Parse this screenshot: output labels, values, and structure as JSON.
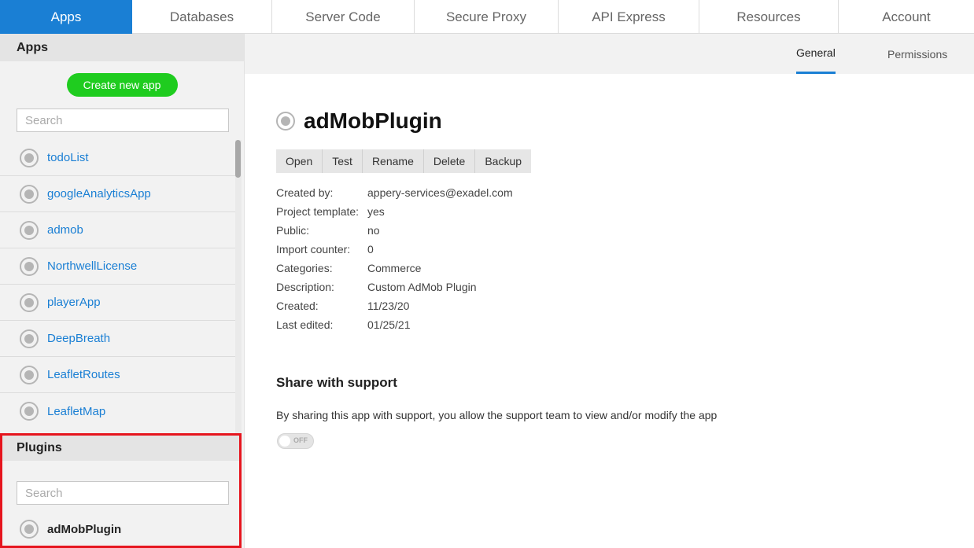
{
  "topnav": {
    "tabs": [
      {
        "label": "Apps",
        "active": true
      },
      {
        "label": "Databases"
      },
      {
        "label": "Server Code"
      },
      {
        "label": "Secure Proxy"
      },
      {
        "label": "API Express"
      },
      {
        "label": "Resources"
      },
      {
        "label": "Account"
      }
    ]
  },
  "sidebar": {
    "apps_heading": "Apps",
    "create_button": "Create new app",
    "apps_search_placeholder": "Search",
    "apps": [
      {
        "label": "todoList"
      },
      {
        "label": "googleAnalyticsApp"
      },
      {
        "label": "admob"
      },
      {
        "label": "NorthwellLicense"
      },
      {
        "label": "playerApp"
      },
      {
        "label": "DeepBreath"
      },
      {
        "label": "LeafletRoutes"
      },
      {
        "label": "LeafletMap"
      }
    ],
    "plugins_heading": "Plugins",
    "plugins_search_placeholder": "Search",
    "plugins": [
      {
        "label": "adMobPlugin"
      }
    ]
  },
  "subnav": {
    "general": "General",
    "permissions": "Permissions"
  },
  "main": {
    "title": "adMobPlugin",
    "actions": {
      "open": "Open",
      "test": "Test",
      "rename": "Rename",
      "delete": "Delete",
      "backup": "Backup"
    },
    "meta": [
      {
        "key": "Created by:",
        "value": "appery-services@exadel.com"
      },
      {
        "key": "Project template:",
        "value": "yes"
      },
      {
        "key": "Public:",
        "value": "no"
      },
      {
        "key": "Import counter:",
        "value": "0"
      },
      {
        "key": "Categories:",
        "value": "Commerce"
      },
      {
        "key": "Description:",
        "value": "Custom AdMob Plugin"
      },
      {
        "key": "Created:",
        "value": "11/23/20"
      },
      {
        "key": "Last edited:",
        "value": "01/25/21"
      }
    ],
    "share_title": "Share with support",
    "share_desc": "By sharing this app with support, you allow the support team to view and/or modify the app",
    "toggle_label": "OFF"
  },
  "colors": {
    "accent": "#1a7fd4",
    "create_green": "#1fcc1f",
    "highlight_red": "#e6151e"
  }
}
